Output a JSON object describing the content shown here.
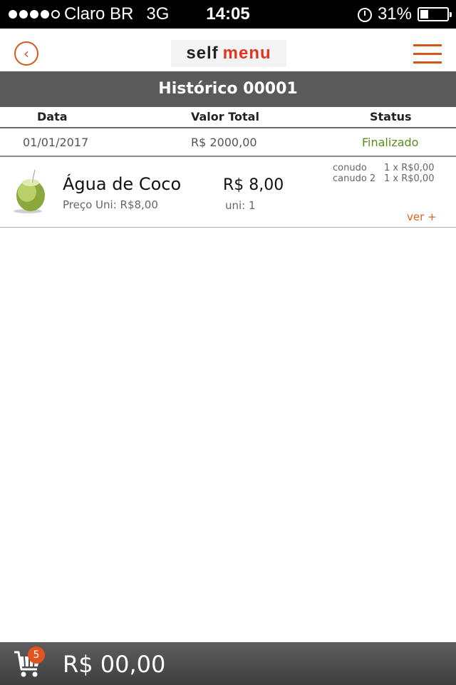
{
  "status_bar": {
    "carrier": "Claro BR",
    "network": "3G",
    "time": "14:05",
    "battery": "31%",
    "battery_level": 0.31,
    "signal_bars_filled": 4,
    "signal_bars_total": 5,
    "icons": [
      "signal-icon",
      "alarm-icon",
      "battery-icon"
    ]
  },
  "header": {
    "logo_self": "self",
    "logo_menu": "menu",
    "back_icon": "chevron-left-icon",
    "menu_icon": "hamburger-menu-icon",
    "accent_color": "#d4581c"
  },
  "title": "Histórico 00001",
  "table": {
    "columns": [
      "Data",
      "Valor Total",
      "Status"
    ],
    "row": {
      "date": "01/01/2017",
      "total": "R$ 2000,00",
      "status": "Finalizado",
      "status_color": "#5c8c1a"
    }
  },
  "item": {
    "name": "Água de Coco",
    "unit_price": "Preço Uni: R$8,00",
    "price": "R$ 8,00",
    "quantity": "uni: 1",
    "extras": [
      {
        "name": "conudo",
        "value": "1 x R$0,00"
      },
      {
        "name": "canudo 2",
        "value": "1 x R$0,00"
      }
    ],
    "more_link": "ver +"
  },
  "footer": {
    "cart_icon": "cart-icon",
    "cart_count": "5",
    "total": "R$ 00,00"
  }
}
